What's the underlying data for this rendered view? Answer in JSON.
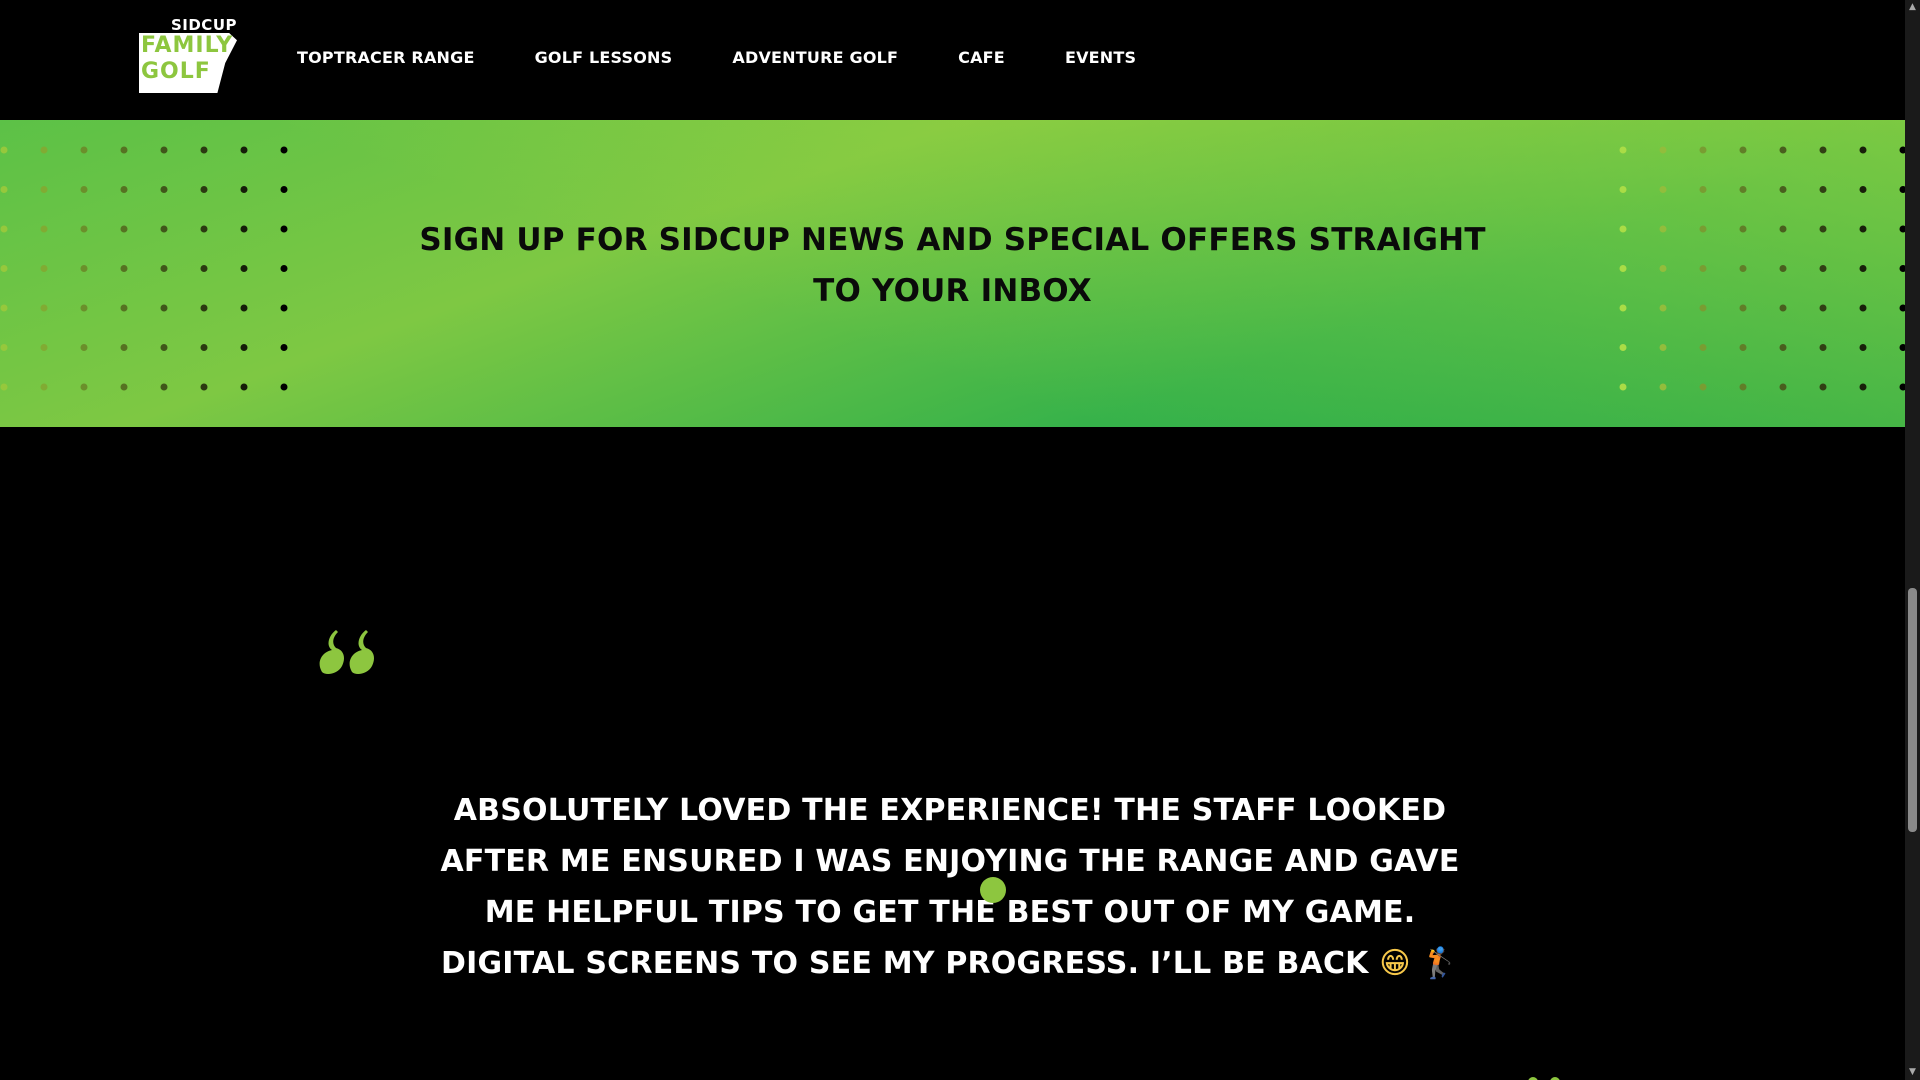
{
  "header": {
    "logo": {
      "top": "SIDCUP",
      "line1": "FAMILY",
      "line2": "GOLF"
    },
    "nav": [
      {
        "label": "TOPTRACER RANGE"
      },
      {
        "label": "GOLF LESSONS"
      },
      {
        "label": "ADVENTURE GOLF"
      },
      {
        "label": "CAFE"
      },
      {
        "label": "EVENTS"
      }
    ]
  },
  "banner": {
    "text": "SIGN UP FOR SIDCUP NEWS AND SPECIAL OFFERS STRAIGHT TO YOUR INBOX"
  },
  "testimonial": {
    "text": "ABSOLUTELY LOVED THE EXPERIENCE! THE STAFF LOOKED AFTER ME ENSURED I WAS ENJOYING THE RANGE AND GAVE ME HELPFUL TIPS TO GET THE BEST OUT OF MY GAME. DIGITAL SCREENS TO SEE MY PROGRESS. I’LL BE BACK",
    "emoji_1": "😁",
    "emoji_2": "🏌"
  },
  "colors": {
    "accent_green": "#8dc63f",
    "banner_green": "#36b24a",
    "background": "#000000"
  },
  "icons": {
    "quote": "quote-mark-icon",
    "scroll_up": "chevron-up-icon",
    "scroll_down": "chevron-down-icon"
  }
}
